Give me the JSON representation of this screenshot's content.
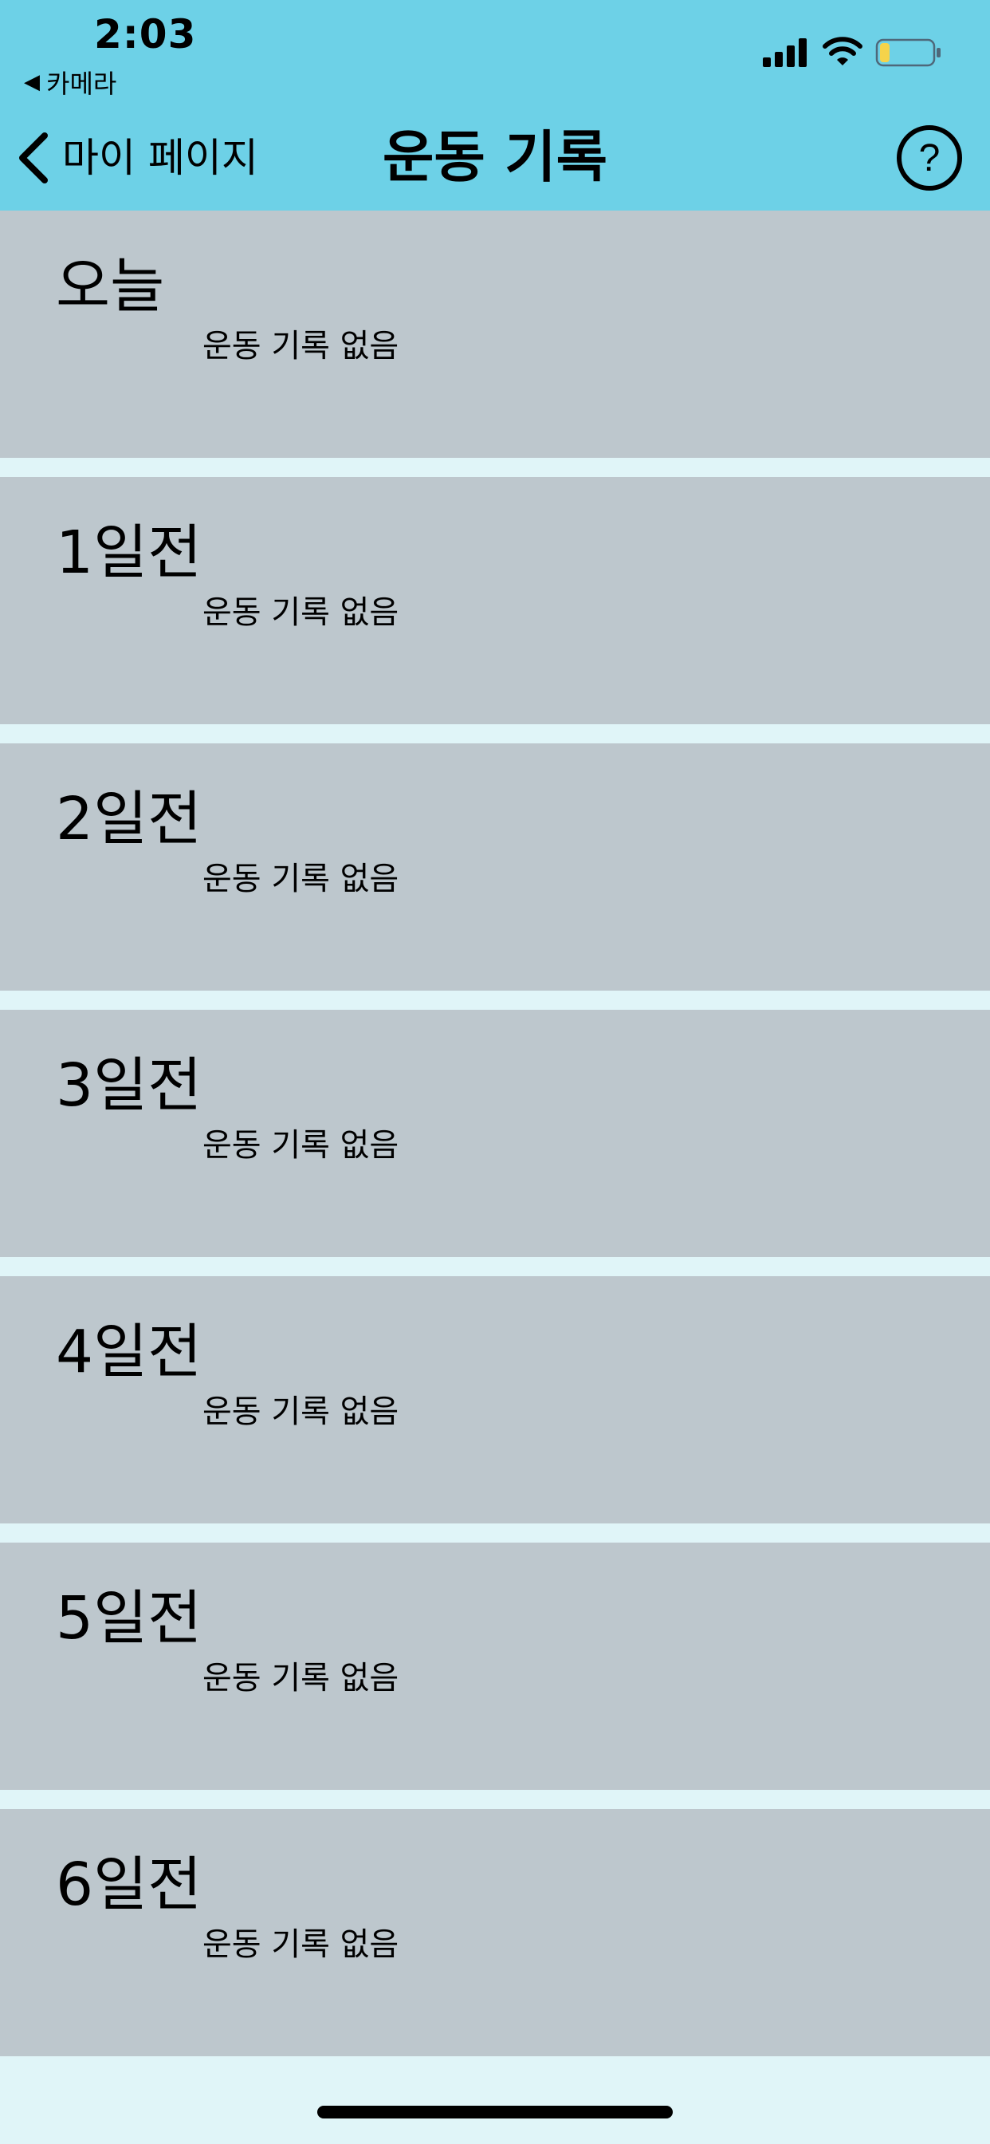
{
  "status_bar": {
    "time": "2:03",
    "back_app_arrow": "◀",
    "back_app_label": "카메라",
    "icons": [
      "signal-icon",
      "wifi-icon",
      "battery-icon"
    ],
    "battery_level": 0.18
  },
  "nav": {
    "back_label": "마이 페이지",
    "title": "운동 기록",
    "help_icon": "question-circle-icon"
  },
  "records": [
    {
      "day": "오늘",
      "status": "운동 기록 없음"
    },
    {
      "day": "1일전",
      "status": "운동 기록 없음"
    },
    {
      "day": "2일전",
      "status": "운동 기록 없음"
    },
    {
      "day": "3일전",
      "status": "운동 기록 없음"
    },
    {
      "day": "4일전",
      "status": "운동 기록 없음"
    },
    {
      "day": "5일전",
      "status": "운동 기록 없음"
    },
    {
      "day": "6일전",
      "status": "운동 기록 없음"
    }
  ],
  "colors": {
    "header": "#6dd1e7",
    "row": "#bdc7cd",
    "background": "#e0f5f8",
    "battery_fill": "#f5d34a"
  }
}
